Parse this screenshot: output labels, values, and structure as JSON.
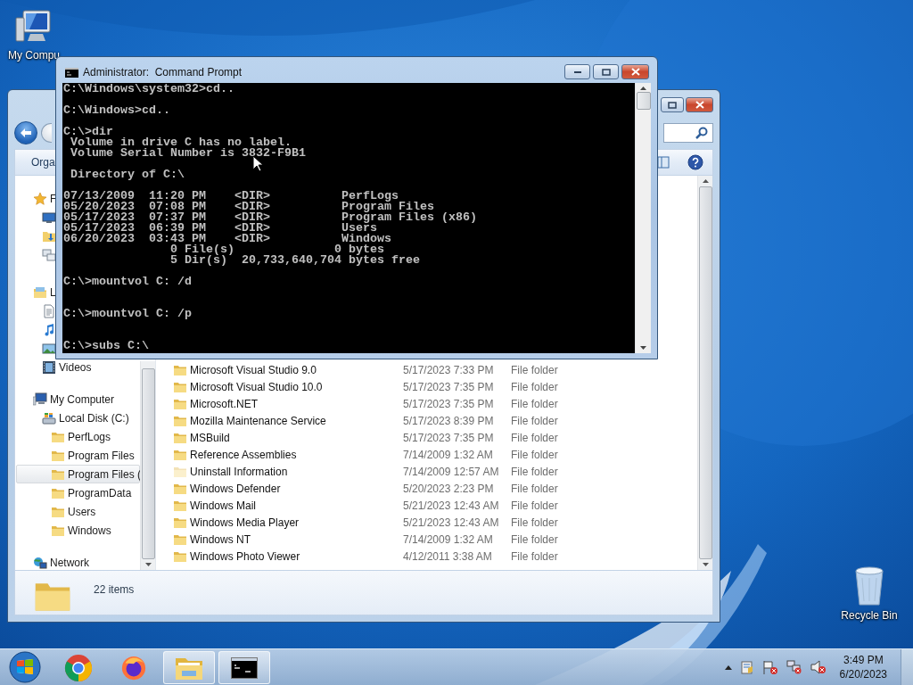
{
  "desktop_icons": [
    {
      "kind": "computer",
      "label": "My Compu"
    },
    {
      "kind": "recycle-bin",
      "label": "Recycle Bin"
    }
  ],
  "explorer": {
    "toolbar": {
      "organize": "Orga"
    },
    "nav_pane": {
      "items": [
        {
          "kind": "favorites",
          "label": "F",
          "selected": false,
          "children": [
            {
              "kind": "desktop",
              "selected": false
            },
            {
              "kind": "downloads",
              "selected": false
            },
            {
              "kind": "recent",
              "selected": false
            }
          ]
        },
        {
          "kind": "libraries",
          "label": "L",
          "selected": false,
          "children": [
            {
              "kind": "documents",
              "selected": false
            },
            {
              "kind": "music",
              "selected": false
            },
            {
              "kind": "pictures",
              "selected": false
            },
            {
              "kind": "videos",
              "label": "Videos",
              "selected": false
            }
          ]
        },
        {
          "kind": "computer",
          "label": "My Computer",
          "selected": false,
          "children": [
            {
              "kind": "drive",
              "label": "Local Disk (C:)",
              "selected": false,
              "children": [
                {
                  "kind": "folder",
                  "label": "PerfLogs",
                  "selected": false
                },
                {
                  "kind": "folder",
                  "label": "Program Files",
                  "selected": false
                },
                {
                  "kind": "folder",
                  "label": "Program Files (",
                  "selected": true
                },
                {
                  "kind": "folder",
                  "label": "ProgramData",
                  "selected": false
                },
                {
                  "kind": "folder",
                  "label": "Users",
                  "selected": false
                },
                {
                  "kind": "folder",
                  "label": "Windows",
                  "selected": false
                }
              ]
            }
          ]
        },
        {
          "kind": "network",
          "label": "Network",
          "selected": false
        }
      ]
    },
    "files": [
      {
        "name": "Microsoft Visual Studio 9.0",
        "date": "5/17/2023 7:33 PM",
        "type": "File folder",
        "hidden": false
      },
      {
        "name": "Microsoft Visual Studio 10.0",
        "date": "5/17/2023 7:35 PM",
        "type": "File folder",
        "hidden": false
      },
      {
        "name": "Microsoft.NET",
        "date": "5/17/2023 7:35 PM",
        "type": "File folder",
        "hidden": false
      },
      {
        "name": "Mozilla Maintenance Service",
        "date": "5/17/2023 8:39 PM",
        "type": "File folder",
        "hidden": false
      },
      {
        "name": "MSBuild",
        "date": "5/17/2023 7:35 PM",
        "type": "File folder",
        "hidden": false
      },
      {
        "name": "Reference Assemblies",
        "date": "7/14/2009 1:32 AM",
        "type": "File folder",
        "hidden": false
      },
      {
        "name": "Uninstall Information",
        "date": "7/14/2009 12:57 AM",
        "type": "File folder",
        "hidden": true
      },
      {
        "name": "Windows Defender",
        "date": "5/20/2023 2:23 PM",
        "type": "File folder",
        "hidden": false
      },
      {
        "name": "Windows Mail",
        "date": "5/21/2023 12:43 AM",
        "type": "File folder",
        "hidden": false
      },
      {
        "name": "Windows Media Player",
        "date": "5/21/2023 12:43 AM",
        "type": "File folder",
        "hidden": false
      },
      {
        "name": "Windows NT",
        "date": "7/14/2009 1:32 AM",
        "type": "File folder",
        "hidden": false
      },
      {
        "name": "Windows Photo Viewer",
        "date": "4/12/2011 3:38 AM",
        "type": "File folder",
        "hidden": false
      }
    ],
    "details": {
      "count": "22 items"
    }
  },
  "cmd": {
    "title": "Administrator:  Command Prompt",
    "lines": [
      {
        "kind": "text",
        "text": "C:\\Windows\\system32>cd.."
      },
      {
        "kind": "blank"
      },
      {
        "kind": "text",
        "text": "C:\\Windows>cd.."
      },
      {
        "kind": "blank"
      },
      {
        "kind": "text",
        "text": "C:\\>dir"
      },
      {
        "kind": "text",
        "text": " Volume in drive C has no label."
      },
      {
        "kind": "text",
        "text": " Volume Serial Number is 3832-F9B1"
      },
      {
        "kind": "blank"
      },
      {
        "kind": "text",
        "text": " Directory of C:\\"
      },
      {
        "kind": "blank"
      },
      {
        "kind": "text",
        "text": "07/13/2009  11:20 PM    <DIR>          PerfLogs"
      },
      {
        "kind": "text",
        "text": "05/20/2023  07:08 PM    <DIR>          Program Files"
      },
      {
        "kind": "text",
        "text": "05/17/2023  07:37 PM    <DIR>          Program Files (x86)"
      },
      {
        "kind": "text",
        "text": "05/17/2023  06:39 PM    <DIR>          Users"
      },
      {
        "kind": "text",
        "text": "06/20/2023  03:43 PM    <DIR>          Windows"
      },
      {
        "kind": "text",
        "text": "               0 File(s)              0 bytes"
      },
      {
        "kind": "text",
        "text": "               5 Dir(s)  20,733,640,704 bytes free"
      },
      {
        "kind": "blank"
      },
      {
        "kind": "text",
        "text": "C:\\>mountvol C: /d"
      },
      {
        "kind": "blank"
      },
      {
        "kind": "blank"
      },
      {
        "kind": "text",
        "text": "C:\\>mountvol C: /p"
      },
      {
        "kind": "blank"
      },
      {
        "kind": "blank"
      },
      {
        "kind": "text",
        "text": "C:\\>subs C:\\"
      }
    ]
  },
  "taskbar": {
    "apps": [
      {
        "kind": "chrome",
        "running": false
      },
      {
        "kind": "firefox",
        "running": false
      },
      {
        "kind": "explorer",
        "running": true
      },
      {
        "kind": "console",
        "running": true
      }
    ],
    "clock": {
      "time": "3:49 PM",
      "date": "6/20/2023"
    }
  }
}
